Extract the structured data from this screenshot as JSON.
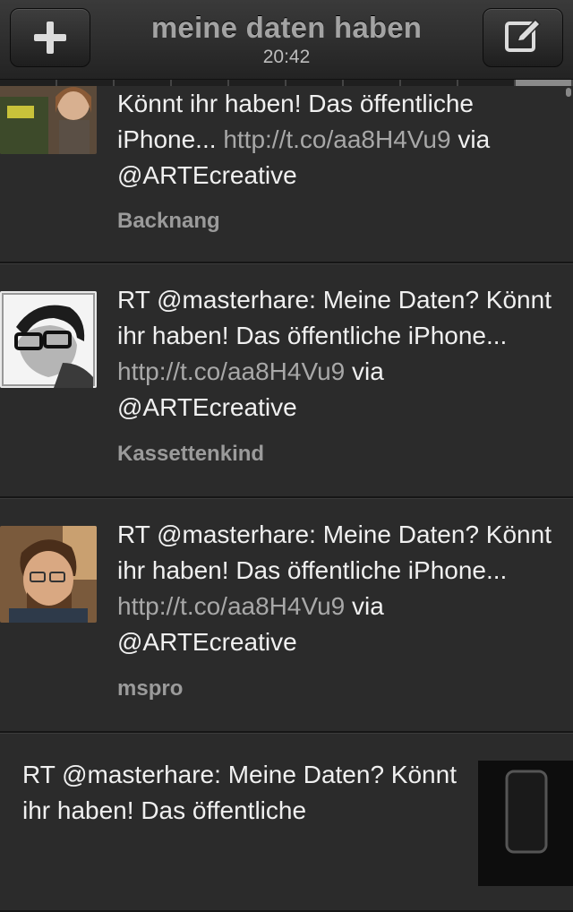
{
  "header": {
    "title": "meine daten haben",
    "time": "20:42"
  },
  "tweets": [
    {
      "text_before": "Könnt ihr haben! Das öffentliche iPhone... ",
      "link": "http://t.co/aa8H4Vu9",
      "text_after": " via @ARTEcreative",
      "author": "Backnang"
    },
    {
      "text_before": "RT @masterhare: Meine Daten? Könnt ihr haben! Das öffentliche iPhone... ",
      "link": "http://t.co/aa8H4Vu9",
      "text_after": " via @ARTEcreative",
      "author": "Kassettenkind"
    },
    {
      "text_before": "RT @masterhare: Meine Daten? Könnt ihr haben! Das öffentliche iPhone... ",
      "link": "http://t.co/aa8H4Vu9",
      "text_after": " via @ARTEcreative",
      "author": "mspro"
    },
    {
      "text_before": "RT @masterhare: Meine Daten? Könnt ihr haben! Das öffentliche",
      "link": "",
      "text_after": "",
      "author": ""
    }
  ],
  "icons": {
    "left_button": "plus-icon",
    "right_button": "compose-icon"
  }
}
